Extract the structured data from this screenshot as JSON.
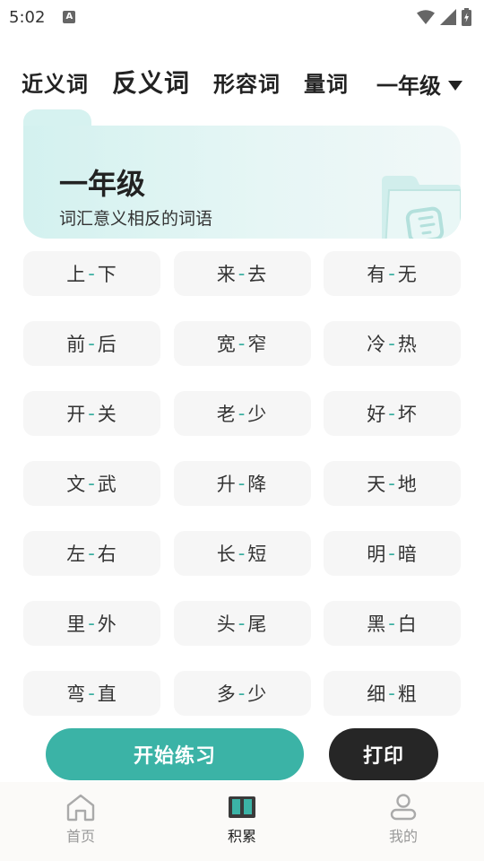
{
  "status": {
    "time": "5:02",
    "notification_glyph": "A"
  },
  "tabs": [
    {
      "label": "近义词",
      "active": false
    },
    {
      "label": "反义词",
      "active": true
    },
    {
      "label": "形容词",
      "active": false
    },
    {
      "label": "量词",
      "active": false
    }
  ],
  "grade_select": {
    "value": "一年级"
  },
  "banner": {
    "title": "一年级",
    "subtitle": "词汇意义相反的词语"
  },
  "pairs": [
    [
      "上",
      "下"
    ],
    [
      "来",
      "去"
    ],
    [
      "有",
      "无"
    ],
    [
      "前",
      "后"
    ],
    [
      "宽",
      "窄"
    ],
    [
      "冷",
      "热"
    ],
    [
      "开",
      "关"
    ],
    [
      "老",
      "少"
    ],
    [
      "好",
      "坏"
    ],
    [
      "文",
      "武"
    ],
    [
      "升",
      "降"
    ],
    [
      "天",
      "地"
    ],
    [
      "左",
      "右"
    ],
    [
      "长",
      "短"
    ],
    [
      "明",
      "暗"
    ],
    [
      "里",
      "外"
    ],
    [
      "头",
      "尾"
    ],
    [
      "黑",
      "白"
    ],
    [
      "弯",
      "直"
    ],
    [
      "多",
      "少"
    ],
    [
      "细",
      "粗"
    ]
  ],
  "separator": "-",
  "actions": {
    "start_label": "开始练习",
    "print_label": "打印"
  },
  "bottom_nav": [
    {
      "label": "首页",
      "icon": "home-icon",
      "active": false
    },
    {
      "label": "积累",
      "icon": "book-icon",
      "active": true
    },
    {
      "label": "我的",
      "icon": "user-icon",
      "active": false
    }
  ],
  "colors": {
    "accent": "#3bb3a6",
    "dark_button": "#262626",
    "banner_bg": "#d6f2f0"
  }
}
